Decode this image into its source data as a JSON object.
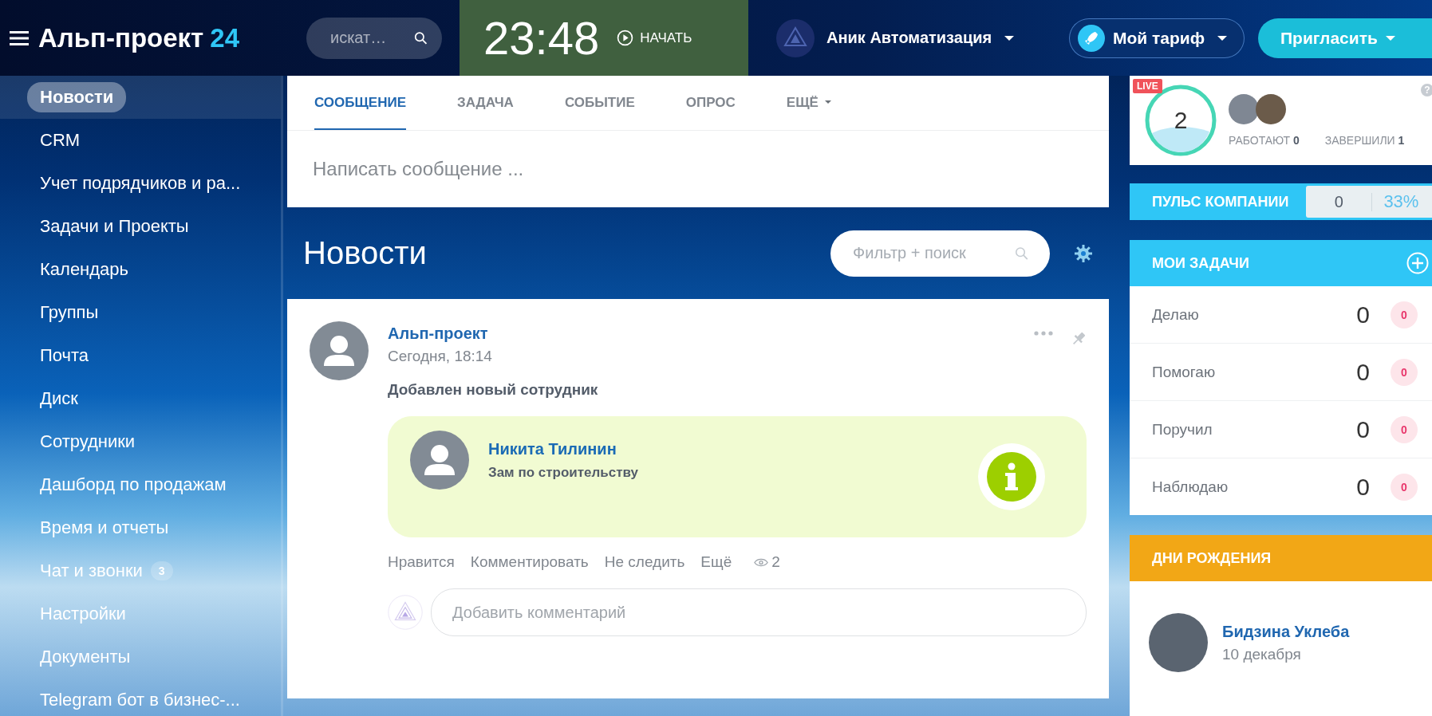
{
  "header": {
    "logo_name": "Альп-проект",
    "logo_number": "24",
    "search": {
      "placeholder": "искат…"
    },
    "clock": {
      "time": "23:48",
      "action": "НАЧАТЬ"
    },
    "user": {
      "name": "Аник Автоматизация"
    },
    "tariff_button": "Мой тариф",
    "invite_button": "Пригласить"
  },
  "sidebar": {
    "items": [
      {
        "label": "Новости",
        "selected": true
      },
      {
        "label": "CRM",
        "selected": false
      },
      {
        "label": "Учет подрядчиков и ра...",
        "selected": false
      },
      {
        "label": "Задачи и Проекты",
        "selected": false
      },
      {
        "label": "Календарь",
        "selected": false
      },
      {
        "label": "Группы",
        "selected": false
      },
      {
        "label": "Почта",
        "selected": false
      },
      {
        "label": "Диск",
        "selected": false
      },
      {
        "label": "Сотрудники",
        "selected": false
      },
      {
        "label": "Дашборд по продажам",
        "selected": false
      },
      {
        "label": "Время и отчеты",
        "selected": false
      },
      {
        "label": "Чат и звонки",
        "selected": false,
        "badge": "3"
      },
      {
        "label": "Настройки",
        "selected": false
      },
      {
        "label": "Документы",
        "selected": false
      },
      {
        "label": "Telegram бот в бизнес-...",
        "selected": false
      }
    ]
  },
  "composer": {
    "tabs": [
      {
        "label": "СООБЩЕНИЕ",
        "selected": true
      },
      {
        "label": "ЗАДАЧА",
        "selected": false
      },
      {
        "label": "СОБЫТИЕ",
        "selected": false
      },
      {
        "label": "ОПРОС",
        "selected": false
      },
      {
        "label": "ЕЩЁ",
        "selected": false,
        "dropdown": true
      }
    ],
    "placeholder": "Написать сообщение ..."
  },
  "feed": {
    "title": "Новости",
    "filter": {
      "placeholder": "Фильтр + поиск"
    },
    "post": {
      "author": "Альп-проект",
      "time": "Сегодня, 18:14",
      "text": "Добавлен новый сотрудник",
      "employee": {
        "name": "Никита Тилинин",
        "position": "Зам по строительству"
      },
      "actions": [
        "Нравится",
        "Комментировать",
        "Не следить",
        "Ещё"
      ],
      "views": "2",
      "comment": {
        "placeholder": "Добавить комментарий"
      }
    }
  },
  "live": {
    "badge": "LIVE",
    "count": "2",
    "working_label": "РАБОТАЮТ",
    "working": "0",
    "finished_label": "ЗАВЕРШИЛИ",
    "finished": "1",
    "help": "?"
  },
  "pulse": {
    "title": "ПУЛЬС КОМПАНИИ",
    "value": "0",
    "percent": "33%"
  },
  "tasks": {
    "title": "МОИ ЗАДАЧИ",
    "rows": [
      {
        "label": "Делаю",
        "count": "0",
        "overdue": "0"
      },
      {
        "label": "Помогаю",
        "count": "0",
        "overdue": "0"
      },
      {
        "label": "Поручил",
        "count": "0",
        "overdue": "0"
      },
      {
        "label": "Наблюдаю",
        "count": "0",
        "overdue": "0"
      }
    ]
  },
  "birthdays": {
    "title": "ДНИ РОЖДЕНИЯ",
    "people": [
      {
        "name": "Бидзина Уклеба",
        "date": "10 декабря"
      }
    ]
  }
}
